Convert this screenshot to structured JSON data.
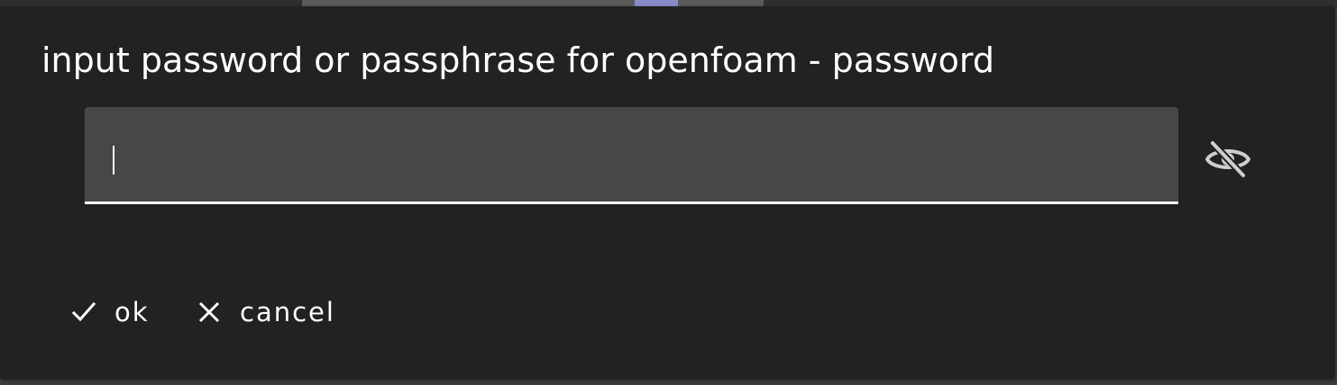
{
  "dialog": {
    "title": "input password or passphrase for openfoam - password",
    "password_field": {
      "value": "",
      "placeholder": "",
      "visibility_icon": "eye-off-icon"
    },
    "actions": {
      "ok": {
        "label": "ok",
        "icon": "check-icon"
      },
      "cancel": {
        "label": "cancel",
        "icon": "close-icon"
      }
    }
  },
  "colors": {
    "dialog_background": "#222222",
    "field_background": "#474747",
    "text": "#ffffff",
    "icon": "#cfcfcf",
    "window_background": "#3f3f3f",
    "accent_tab": "#8b8bc8"
  }
}
